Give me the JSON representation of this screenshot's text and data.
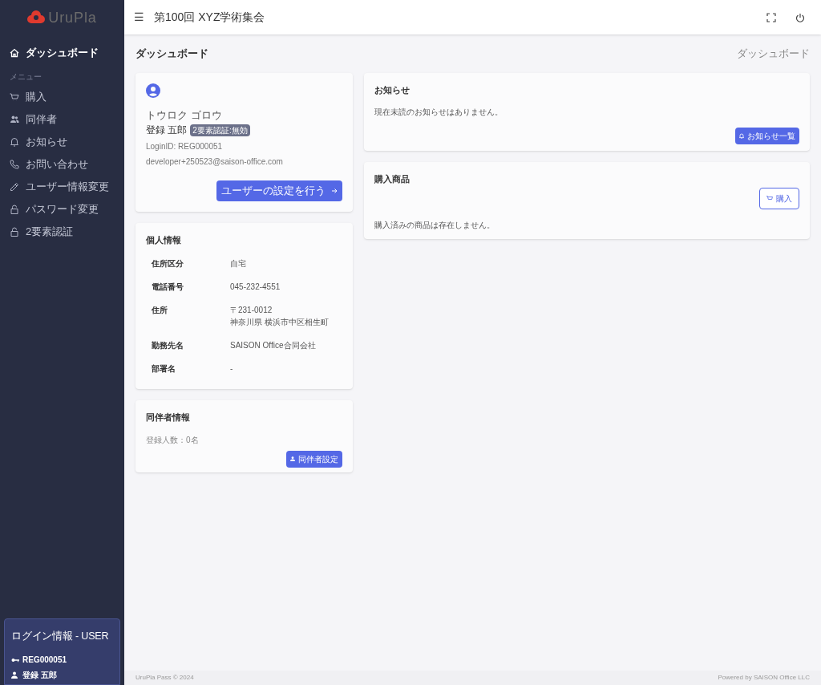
{
  "sidebar": {
    "logo": "UruPla",
    "items": [
      {
        "label": "ダッシュボード",
        "selected": true
      }
    ],
    "section_title": "メニュー",
    "menu": [
      {
        "label": "購入",
        "selected": false
      },
      {
        "label": "同伴者",
        "selected": false
      },
      {
        "label": "お知らせ",
        "selected": false
      },
      {
        "label": "お問い合わせ",
        "selected": false
      },
      {
        "label": "ユーザー情報変更",
        "selected": false
      },
      {
        "label": "パスワード変更",
        "selected": false
      },
      {
        "label": "2要素認証",
        "selected": false
      }
    ],
    "login_info": {
      "title": "ログイン情報 - USER",
      "id": "REG000051",
      "name": "登録 五郎"
    }
  },
  "header": {
    "menu_icon": "☰",
    "title": "第100回 XYZ学術集会"
  },
  "page": {
    "title": "ダッシュボード",
    "breadcrumb": "ダッシュボード"
  },
  "profile": {
    "kana": "トウロク ゴロウ",
    "name": "登録 五郎",
    "badge": "2要素認証:無効",
    "login_id": "LoginID: REG000051",
    "email": "developer+250523@saison-office.com",
    "button": "ユーザーの設定を行う"
  },
  "personal_info": {
    "title": "個人情報",
    "rows": [
      {
        "label": "住所区分",
        "value": "自宅"
      },
      {
        "label": "電話番号",
        "value": "045-232-4551"
      },
      {
        "label": "住所",
        "value": "〒231-0012\n神奈川県 横浜市中区相生町"
      },
      {
        "label": "勤務先名",
        "value": "SAISON Office合同会社"
      },
      {
        "label": "部署名",
        "value": "-"
      }
    ]
  },
  "companions": {
    "title": "同伴者情報",
    "count_label": "登録人数：",
    "count": "0名",
    "button": "同伴者設定"
  },
  "notices": {
    "title": "お知らせ",
    "message": "現在未読のお知らせはありません。",
    "button": "お知らせ一覧"
  },
  "purchases": {
    "title": "購入商品",
    "button": "購入",
    "message": "購入済みの商品は存在しません。"
  },
  "footer": {
    "left": "UruPla Pass © 2024",
    "right": "Powered by SAISON Office LLC"
  }
}
